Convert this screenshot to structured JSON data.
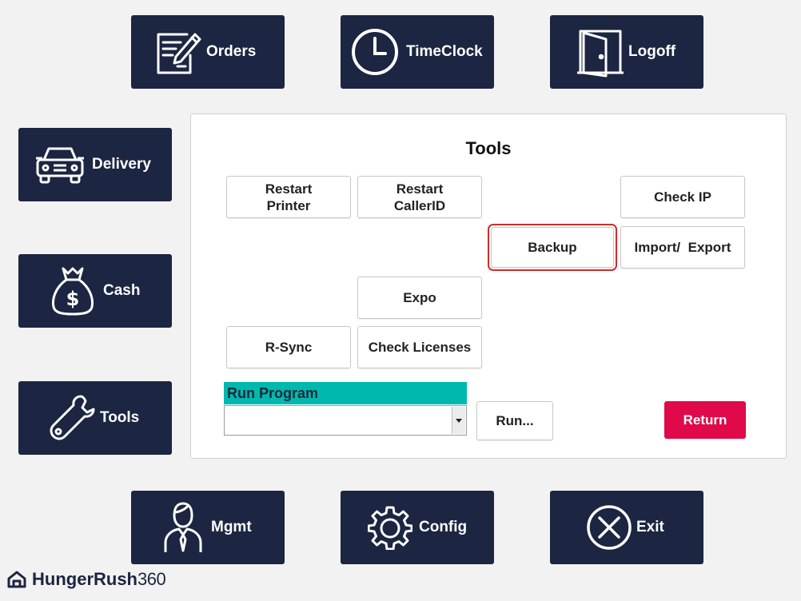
{
  "nav": {
    "orders": "Orders",
    "timeclock": "TimeClock",
    "logoff": "Logoff",
    "delivery": "Delivery",
    "cash": "Cash",
    "tools": "Tools",
    "mgmt": "Mgmt",
    "config": "Config",
    "exit": "Exit"
  },
  "tools_panel": {
    "title": "Tools",
    "buttons": {
      "restart_printer": "Restart\nPrinter",
      "restart_callerid": "Restart\nCallerID",
      "check_ip": "Check IP",
      "backup": "Backup",
      "import_export": "Import/  Export",
      "expo": "Expo",
      "rsync": "R-Sync",
      "check_licenses": "Check Licenses"
    },
    "run_program": {
      "label": "Run Program",
      "selected": "",
      "run_button": "Run..."
    },
    "return_button": "Return"
  },
  "brand": {
    "name": "HungerRush",
    "suffix": "360"
  },
  "colors": {
    "nav_bg": "#1c2541",
    "run_label_bg": "#00b8ae",
    "return_bg": "#e0094a",
    "highlight": "#d42a2a"
  },
  "icons": [
    "orders-icon",
    "clock-icon",
    "door-icon",
    "car-icon",
    "money-bag-icon",
    "wrench-icon",
    "person-icon",
    "gear-icon",
    "close-circle-icon",
    "chevron-down-icon",
    "hungerrush-logo-icon"
  ]
}
